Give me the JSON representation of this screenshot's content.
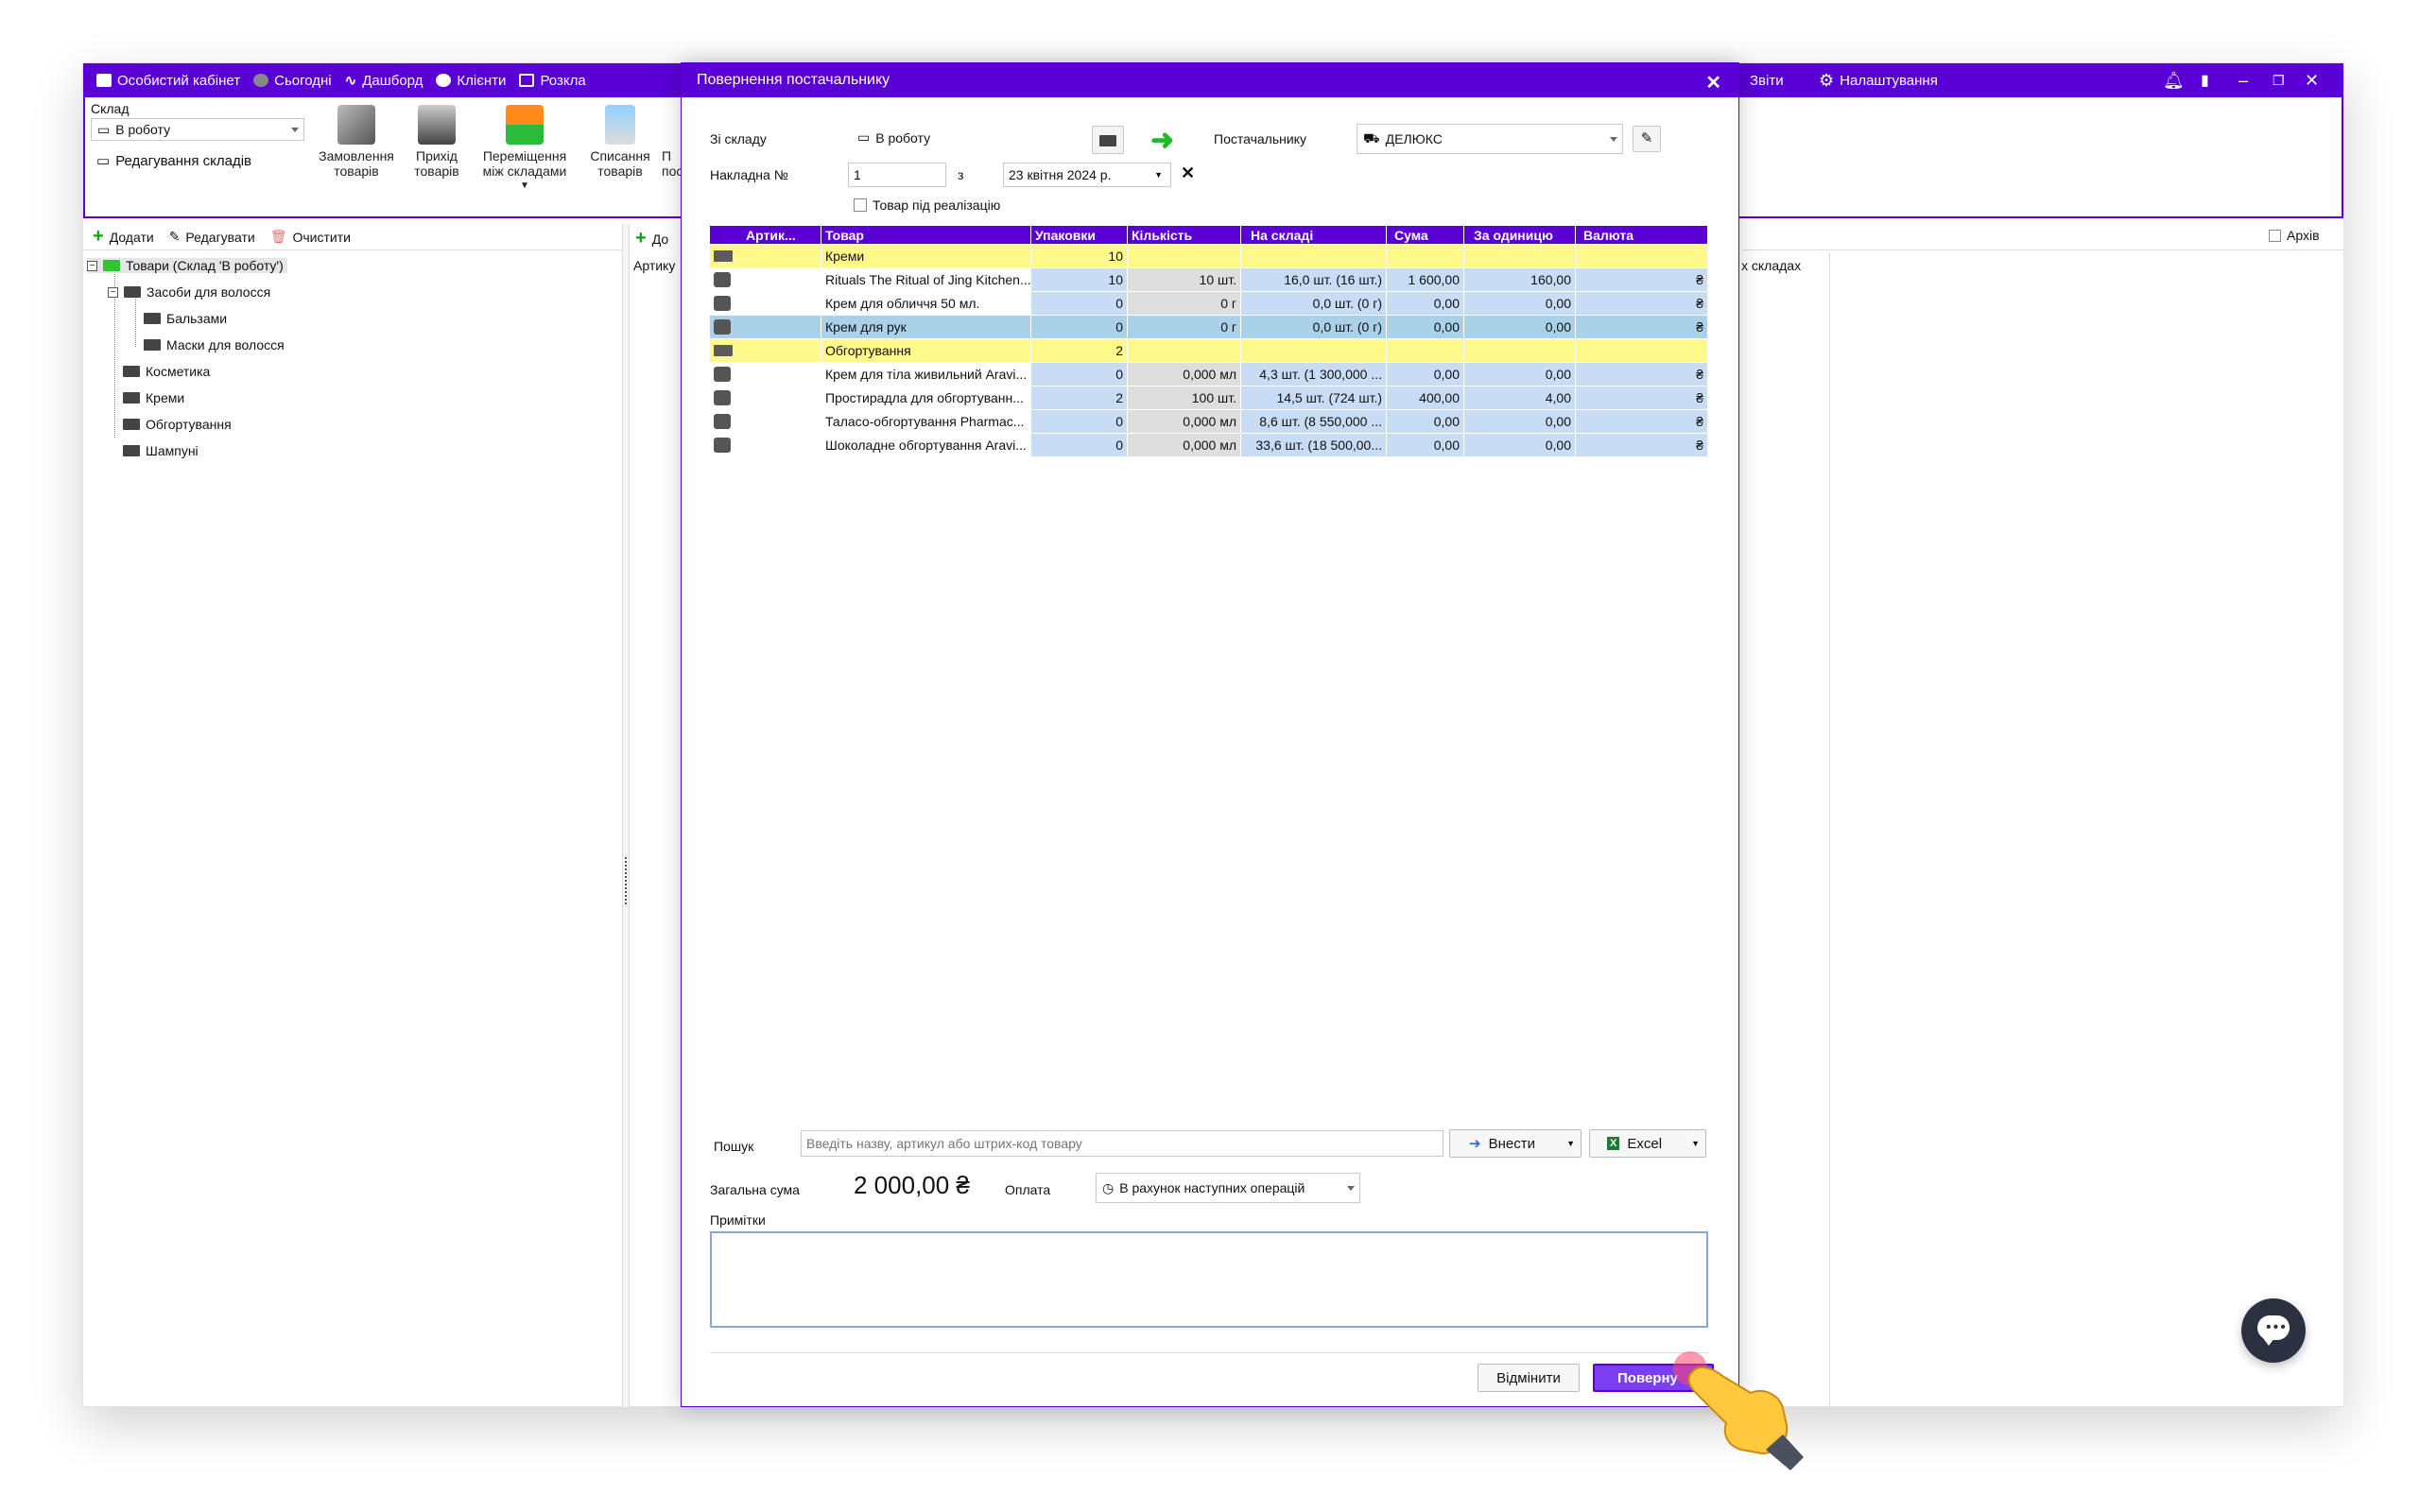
{
  "topbar": {
    "items": [
      "Особистий кабінет",
      "Сьогодні",
      "Дашборд",
      "Клієнти",
      "Розкла"
    ],
    "right": [
      "Звіти",
      "Налаштування"
    ],
    "colors": {
      "accent": "#5a00d6"
    }
  },
  "ribbon": {
    "warehouse_label": "Склад",
    "warehouse_value": "В роботу",
    "edit_warehouses": "Редагування складів",
    "buttons": [
      {
        "l1": "Замовлення",
        "l2": "товарів"
      },
      {
        "l1": "Прихід",
        "l2": "товарів"
      },
      {
        "l1": "Переміщення",
        "l2": "між складами"
      },
      {
        "l1": "Списання",
        "l2": "товарів"
      },
      {
        "l1": "П",
        "l2": "пос"
      }
    ]
  },
  "sidebar": {
    "add": "Додати",
    "edit": "Редагувати",
    "clear": "Очистити",
    "tree": [
      "Товари (Склад 'В роботу')",
      "Засоби для волосся",
      "Бальзами",
      "Маски для волосся",
      "Косметика",
      "Креми",
      "Обгортування",
      "Шампуні"
    ]
  },
  "middle": {
    "add": "До",
    "col": "Артику"
  },
  "rightpane": {
    "archive": "Архів",
    "col": "х складах"
  },
  "modal": {
    "title": "Повернення постачальнику",
    "from_label": "Зі складу",
    "from_value": "В роботу",
    "supplier_label": "Постачальнику",
    "supplier_value": "ДЕЛЮКС",
    "invoice_label": "Накладна  №",
    "invoice_no": "1",
    "date_prefix": "з",
    "date_value": "23 квітня 2024 р.",
    "consignment_label": "Товар під реалізацію",
    "columns": [
      "Артик...",
      "Товар",
      "Упаковки",
      "Кількість",
      "На складі",
      "Сума",
      "За одиницю",
      "Валюта"
    ],
    "rows": [
      {
        "type": "group",
        "name": "Креми",
        "packs": "10"
      },
      {
        "type": "item",
        "name": "Rituals The Ritual of Jing Kitchen...",
        "packs": "10",
        "qty": "10 шт.",
        "stock": "16,0 шт. (16 шт.)",
        "sum": "1 600,00",
        "unit": "160,00",
        "cur": "₴",
        "hl": false
      },
      {
        "type": "item",
        "name": "Крем для обличчя 50 мл.",
        "packs": "0",
        "qty": "0 г",
        "stock": "0,0 шт. (0 г)",
        "sum": "0,00",
        "unit": "0,00",
        "cur": "₴",
        "hl": false
      },
      {
        "type": "item",
        "name": "Крем для рук",
        "packs": "0",
        "qty": "0 г",
        "stock": "0,0 шт. (0 г)",
        "sum": "0,00",
        "unit": "0,00",
        "cur": "₴",
        "hl": true
      },
      {
        "type": "group",
        "name": "Обгортування",
        "packs": "2"
      },
      {
        "type": "item",
        "name": "Крем для тіла живильний Aravi...",
        "packs": "0",
        "qty": "0,000 мл",
        "stock": "4,3 шт. (1 300,000 ...",
        "sum": "0,00",
        "unit": "0,00",
        "cur": "₴",
        "hl": false
      },
      {
        "type": "item",
        "name": "Простирадла для обгортуванн...",
        "packs": "2",
        "qty": "100 шт.",
        "stock": "14,5 шт. (724 шт.)",
        "sum": "400,00",
        "unit": "4,00",
        "cur": "₴",
        "hl": false
      },
      {
        "type": "item",
        "name": "Таласо-обгортування Pharmac...",
        "packs": "0",
        "qty": "0,000 мл",
        "stock": "8,6 шт. (8 550,000 ...",
        "sum": "0,00",
        "unit": "0,00",
        "cur": "₴",
        "hl": false
      },
      {
        "type": "item",
        "name": "Шоколадне обгортування Aravi...",
        "packs": "0",
        "qty": "0,000 мл",
        "stock": "33,6 шт. (18 500,00...",
        "sum": "0,00",
        "unit": "0,00",
        "cur": "₴",
        "hl": false
      }
    ],
    "search_label": "Пошук",
    "search_placeholder": "Введіть назву, артикул або штрих-код товару",
    "insert_label": "Внести",
    "excel_label": "Excel",
    "total_label": "Загальна сума",
    "total_value": "2 000,00 ₴",
    "payment_label": "Оплата",
    "payment_value": "В рахунок наступних операцій",
    "notes_label": "Примітки",
    "notes_value": "",
    "cancel_label": "Відмінити",
    "submit_label": "Поверну"
  }
}
